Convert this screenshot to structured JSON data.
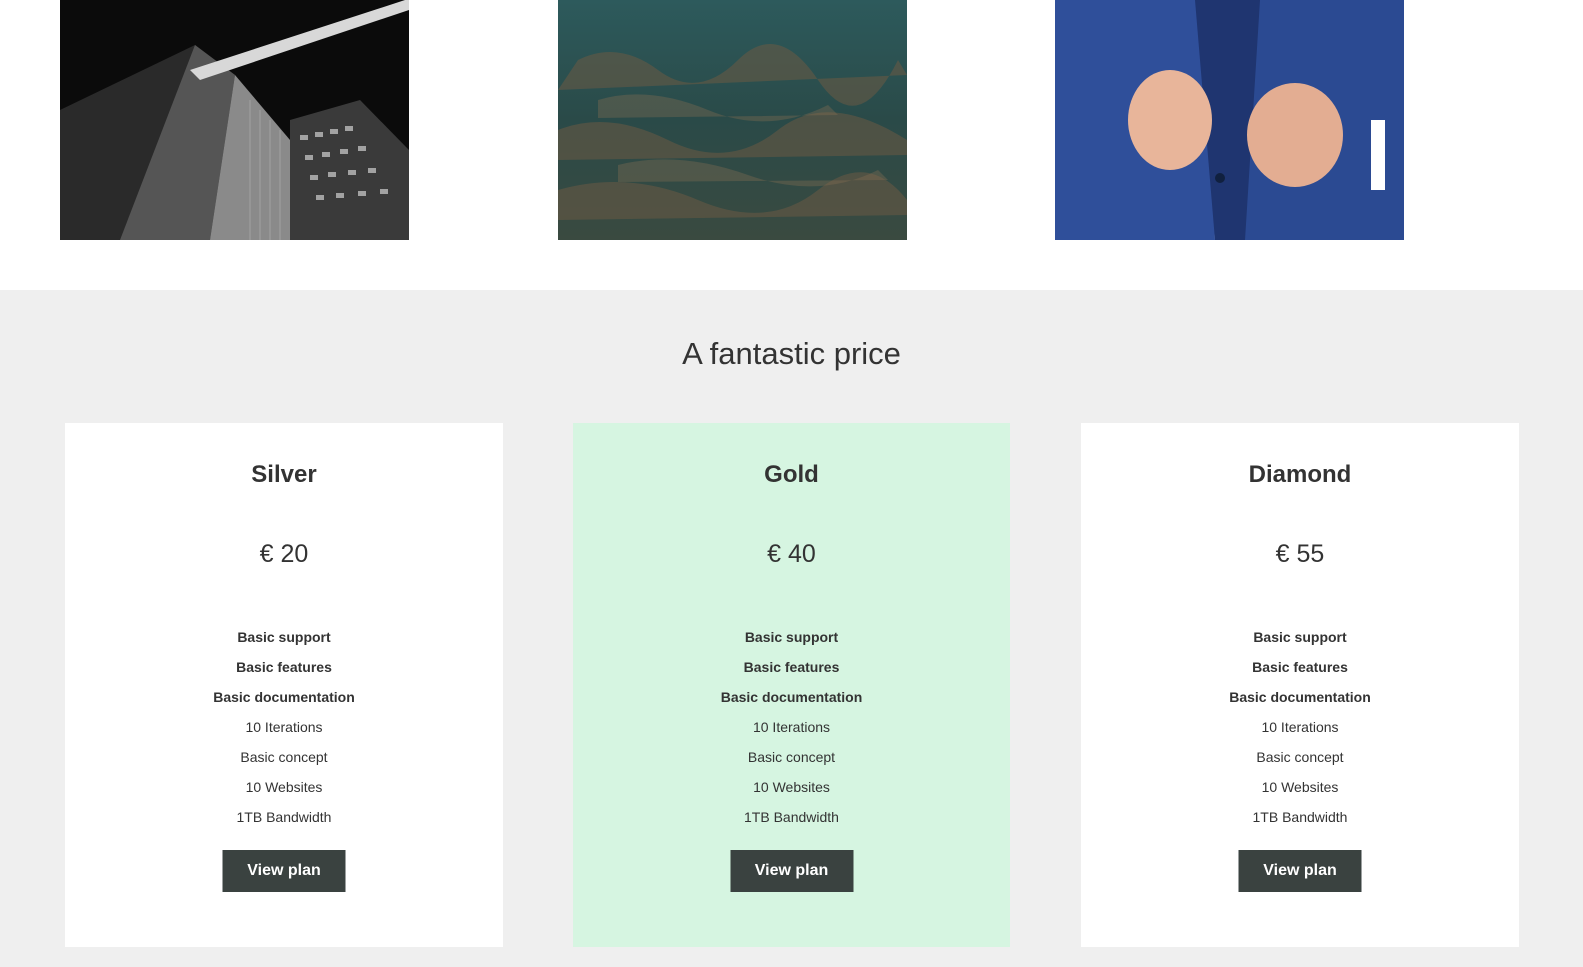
{
  "gallery": {
    "photos": [
      {
        "icon": "skyscrapers-photo"
      },
      {
        "icon": "aerial-landscape-photo"
      },
      {
        "icon": "business-suit-photo"
      }
    ]
  },
  "pricing": {
    "title": "A fantastic price",
    "accent_color": "#d6f5e1",
    "button_color": "#3a4240",
    "plans": [
      {
        "name": "Silver",
        "price": "€ 20",
        "featured": false,
        "features": [
          "Basic support",
          "Basic features",
          "Basic documentation",
          "10 Iterations",
          "Basic concept",
          "10 Websites",
          "1TB Bandwidth"
        ],
        "button_label": "View plan"
      },
      {
        "name": "Gold",
        "price": "€ 40",
        "featured": true,
        "features": [
          "Basic support",
          "Basic features",
          "Basic documentation",
          "10 Iterations",
          "Basic concept",
          "10 Websites",
          "1TB Bandwidth"
        ],
        "button_label": "View plan"
      },
      {
        "name": "Diamond",
        "price": "€ 55",
        "featured": false,
        "features": [
          "Basic support",
          "Basic features",
          "Basic documentation",
          "10 Iterations",
          "Basic concept",
          "10 Websites",
          "1TB Bandwidth"
        ],
        "button_label": "View plan"
      }
    ]
  }
}
